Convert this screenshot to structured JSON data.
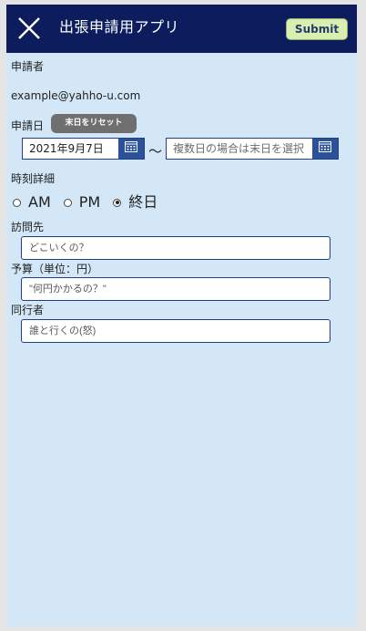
{
  "header": {
    "title": "出張申請用アプリ",
    "submit_label": "Submit",
    "close_icon": "close-icon"
  },
  "form": {
    "applicant_label": "申請者",
    "applicant_value": "example@yahho-u.com",
    "date_label": "申請日",
    "reset_label": "末日をリセット",
    "start_date": "2021年9月7日",
    "separator": "〜",
    "end_date_placeholder": "複数日の場合は末日を選択",
    "time_label": "時刻詳細",
    "time_options": [
      "AM",
      "PM",
      "終日"
    ],
    "time_selected": "終日",
    "destination_label": "訪問先",
    "destination_placeholder": "どこいくの？",
    "budget_label": "予算（単位：円）",
    "budget_placeholder": "\"何円かかるの？\"",
    "companion_label": "同行者",
    "companion_placeholder": "誰と行くの(怒)"
  },
  "colors": {
    "header_bg": "#0c1c5c",
    "body_bg": "#d3e7f6",
    "submit_bg": "#d9efb1",
    "reset_bg": "#6f6f6f",
    "calendar_btn": "#2a5199"
  }
}
